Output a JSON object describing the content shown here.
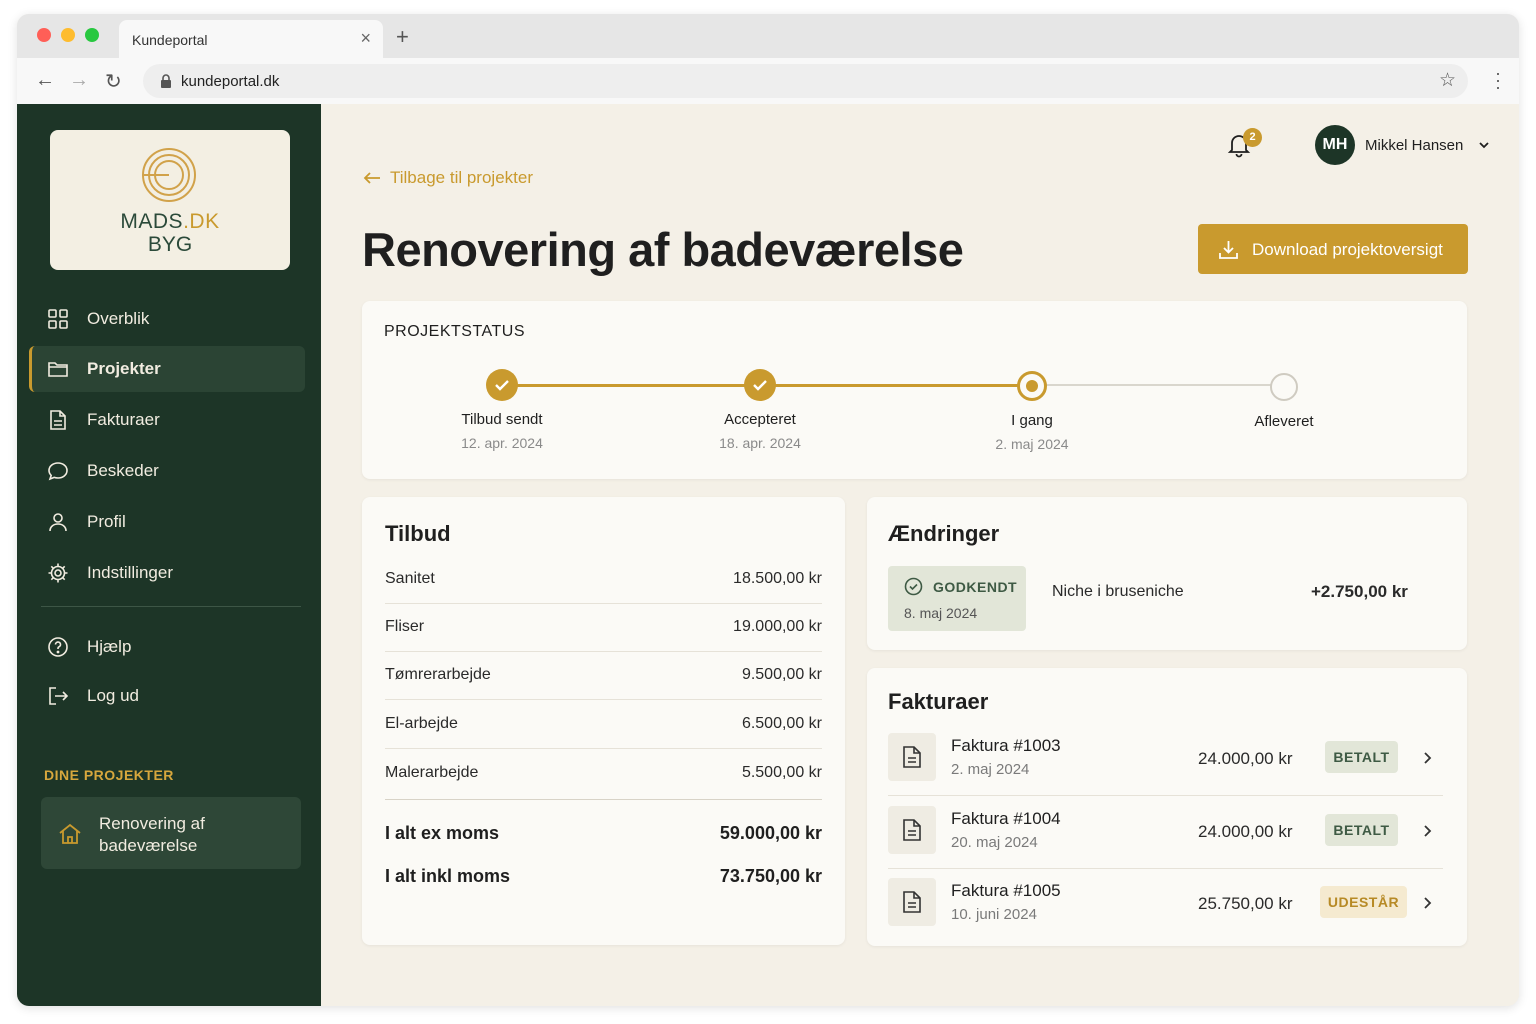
{
  "browser": {
    "tab_title": "Kundeportal",
    "url": "kundeportal.dk"
  },
  "sidebar": {
    "logo": {
      "line1_main": "MADS",
      "line1_accent": ".DK",
      "line2": "BYG"
    },
    "items": [
      {
        "label": "Overblik",
        "icon": "grid-icon"
      },
      {
        "label": "Projekter",
        "icon": "folder-icon",
        "active": true
      },
      {
        "label": "Fakturaer",
        "icon": "document-icon"
      },
      {
        "label": "Beskeder",
        "icon": "chat-bubble-icon"
      },
      {
        "label": "Profil",
        "icon": "user-icon"
      },
      {
        "label": "Indstillinger",
        "icon": "gear-icon"
      }
    ],
    "secondary_items": [
      {
        "label": "Hjælp",
        "icon": "help-icon"
      },
      {
        "label": "Log ud",
        "icon": "logout-icon"
      }
    ],
    "projects_heading": "DINE PROJEKTER",
    "project": {
      "label": "Renovering af badeværelse",
      "icon": "house-icon"
    }
  },
  "header": {
    "notification_count": "2",
    "user_initials": "MH",
    "user_name": "Mikkel Hansen"
  },
  "main": {
    "back_link": "Tilbage til projekter",
    "title": "Renovering af badeværelse",
    "download_button": "Download projektoversigt"
  },
  "status": {
    "title": "PROJEKTSTATUS",
    "steps": [
      {
        "label": "Tilbud sendt",
        "date": "12. apr. 2024",
        "state": "done"
      },
      {
        "label": "Accepteret",
        "date": "18. apr. 2024",
        "state": "done"
      },
      {
        "label": "I gang",
        "date": "2. maj 2024",
        "state": "current"
      },
      {
        "label": "Afleveret",
        "date": "",
        "state": "pending"
      }
    ]
  },
  "offer": {
    "title": "Tilbud",
    "rows": [
      {
        "name": "Sanitet",
        "amount": "18.500,00 kr"
      },
      {
        "name": "Fliser",
        "amount": "19.000,00 kr"
      },
      {
        "name": "Tømrerarbejde",
        "amount": "9.500,00 kr"
      },
      {
        "name": "El-arbejde",
        "amount": "6.500,00 kr"
      },
      {
        "name": "Malerarbejde",
        "amount": "5.500,00 kr"
      }
    ],
    "total_ex_label": "I alt ex moms",
    "total_ex_amount": "59.000,00 kr",
    "total_incl_label": "I alt inkl moms",
    "total_incl_amount": "73.750,00 kr"
  },
  "changes": {
    "title": "Ændringer",
    "status": "GODKENDT",
    "date": "8. maj 2024",
    "description": "Niche i bruseniche",
    "amount": "+2.750,00 kr"
  },
  "invoices": {
    "title": "Fakturaer",
    "items": [
      {
        "title": "Faktura #1003",
        "date": "2. maj 2024",
        "amount": "24.000,00 kr",
        "status": "BETALT",
        "kind": "paid"
      },
      {
        "title": "Faktura #1004",
        "date": "20. maj 2024",
        "amount": "24.000,00 kr",
        "status": "BETALT",
        "kind": "paid"
      },
      {
        "title": "Faktura #1005",
        "date": "10. juni 2024",
        "amount": "25.750,00 kr",
        "status": "UDESTÅR",
        "kind": "due"
      }
    ]
  },
  "colors": {
    "sidebar": "#1d3527",
    "accent": "#c99a2e",
    "background": "#f4f0e7",
    "paid_badge": "#e2e6d8",
    "due_badge": "#f5ead0"
  }
}
